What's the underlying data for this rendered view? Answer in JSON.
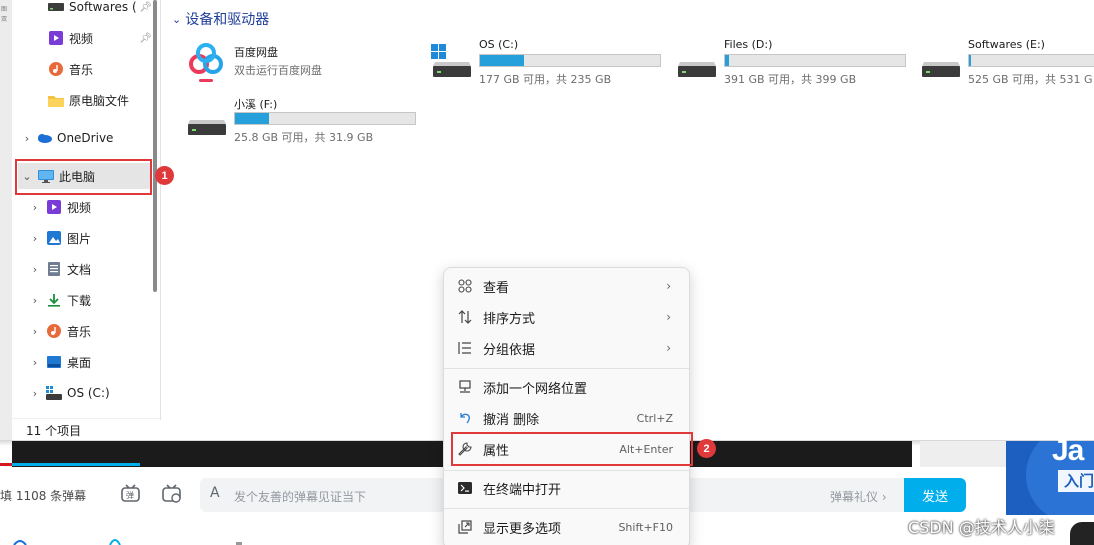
{
  "nav": {
    "items": [
      {
        "label": "Softwares (",
        "icon": "drive-icon"
      },
      {
        "label": "视频",
        "icon": "video-icon"
      },
      {
        "label": "音乐",
        "icon": "music-icon"
      },
      {
        "label": "原电脑文件",
        "icon": "folder-icon"
      },
      {
        "label": "OneDrive",
        "icon": "cloud-icon"
      },
      {
        "label": "此电脑",
        "icon": "monitor-icon"
      },
      {
        "label": "视频",
        "icon": "video-icon"
      },
      {
        "label": "图片",
        "icon": "picture-icon"
      },
      {
        "label": "文档",
        "icon": "document-icon"
      },
      {
        "label": "下载",
        "icon": "download-icon"
      },
      {
        "label": "音乐",
        "icon": "music-icon"
      },
      {
        "label": "桌面",
        "icon": "desktop-icon"
      },
      {
        "label": "OS (C:)",
        "icon": "windows-drive-icon"
      }
    ],
    "status": "11 个项目",
    "side_text_1": "图",
    "side_text_2": "双"
  },
  "markers": {
    "first": "1",
    "second": "2"
  },
  "main": {
    "group_title": "设备和驱动器",
    "app": {
      "name": "百度网盘",
      "subtitle": "双击运行百度网盘"
    },
    "drives": [
      {
        "name": "OS (C:)",
        "info": "177 GB 可用，共 235 GB",
        "used_fraction": 0.247
      },
      {
        "name": "Files (D:)",
        "info": "391 GB 可用，共 399 GB",
        "used_fraction": 0.02
      },
      {
        "name": "Softwares (E:)",
        "info": "525 GB 可用，共 531 G",
        "used_fraction": 0.011
      },
      {
        "name": "小溪 (F:)",
        "info": "25.8 GB 可用，共 31.9 GB",
        "used_fraction": 0.19
      }
    ]
  },
  "context_menu": {
    "items": [
      {
        "label": "查看",
        "icon": "grid-icon",
        "submenu": true
      },
      {
        "label": "排序方式",
        "icon": "sort-icon",
        "submenu": true
      },
      {
        "label": "分组依据",
        "icon": "group-icon",
        "submenu": true
      },
      {
        "label": "添加一个网络位置",
        "icon": "network-icon"
      },
      {
        "label": "撤消 删除",
        "icon": "undo-icon",
        "shortcut": "Ctrl+Z"
      },
      {
        "label": "属性",
        "icon": "wrench-icon",
        "shortcut": "Alt+Enter"
      },
      {
        "label": "在终端中打开",
        "icon": "terminal-icon"
      },
      {
        "label": "显示更多选项",
        "icon": "share-icon",
        "shortcut": "Shift+F10"
      }
    ],
    "arrow": "›"
  },
  "danmaku": {
    "count": "填 1108 条弹幕",
    "font_icon": "A",
    "placeholder": "发个友善的弹幕见证当下",
    "etiquette": "弹幕礼仪 ›",
    "send": "发送"
  },
  "ad": {
    "text1": "Ja",
    "text2": "入门"
  },
  "watermark": "CSDN @技术人小柒",
  "colors": {
    "accent": "#26a0da",
    "highlight": "#e0393b",
    "send": "#00aeec"
  }
}
